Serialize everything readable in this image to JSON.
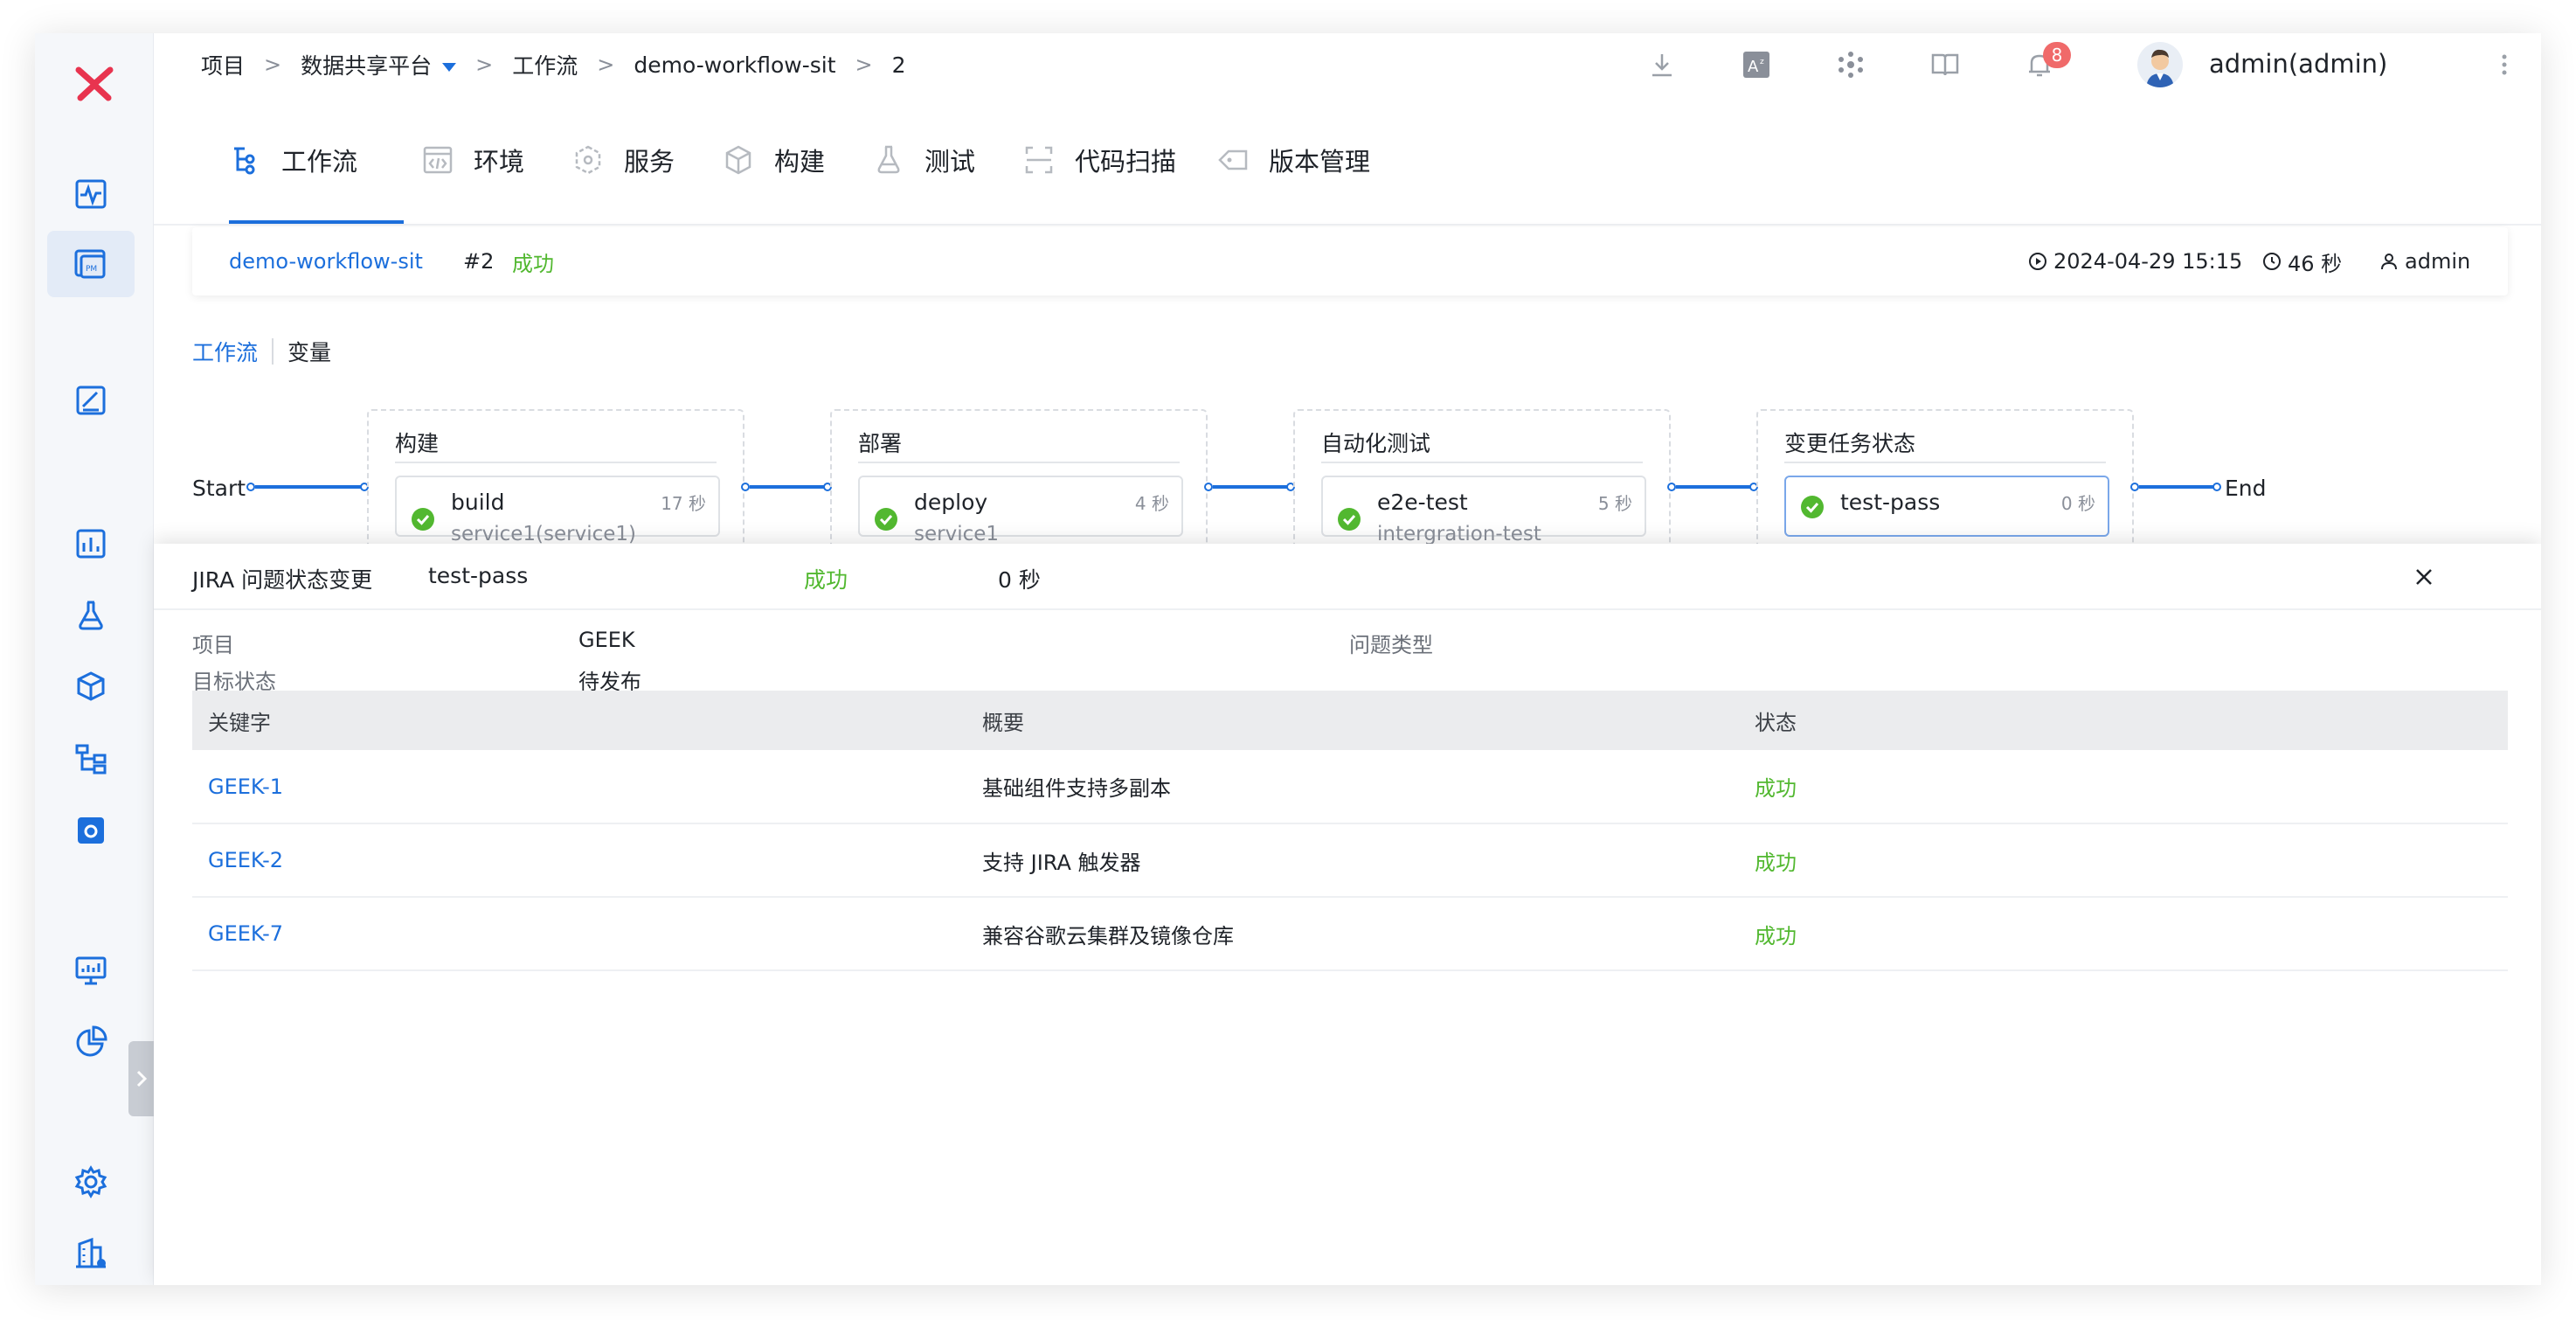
{
  "breadcrumb": {
    "items": [
      "项目",
      "数据共享平台",
      "工作流",
      "demo-workflow-sit",
      "2"
    ],
    "separator": ">"
  },
  "header": {
    "notification_count": "8",
    "username": "admin(admin)"
  },
  "tabs": [
    {
      "label": "工作流",
      "icon": "workflow-icon"
    },
    {
      "label": "环境",
      "icon": "code-icon"
    },
    {
      "label": "服务",
      "icon": "service-icon"
    },
    {
      "label": "构建",
      "icon": "cube-icon"
    },
    {
      "label": "测试",
      "icon": "flask-icon"
    },
    {
      "label": "代码扫描",
      "icon": "scan-icon"
    },
    {
      "label": "版本管理",
      "icon": "tag-icon"
    }
  ],
  "summary": {
    "workflow": "demo-workflow-sit",
    "run": "#2",
    "status": "成功",
    "started_at": "2024-04-29 15:15",
    "duration": "46 秒",
    "creator": "admin"
  },
  "subtabs": [
    "工作流",
    "变量"
  ],
  "pipeline": {
    "start_label": "Start",
    "end_label": "End",
    "stages": [
      {
        "title": "构建",
        "job": {
          "name": "build",
          "sub": "service1(service1)",
          "time": "17 秒"
        }
      },
      {
        "title": "部署",
        "job": {
          "name": "deploy",
          "sub": "service1",
          "time": "4 秒"
        }
      },
      {
        "title": "自动化测试",
        "job": {
          "name": "e2e-test",
          "sub": "intergration-test",
          "time": "5 秒"
        }
      },
      {
        "title": "变更任务状态",
        "job": {
          "name": "test-pass",
          "sub": "",
          "time": "0 秒"
        }
      }
    ]
  },
  "drawer": {
    "title": "JIRA 问题状态变更",
    "job": "test-pass",
    "status": "成功",
    "duration": "0 秒",
    "meta": {
      "project_label": "项目",
      "project_value": "GEEK",
      "issue_type_label": "问题类型",
      "target_status_label": "目标状态",
      "target_status_value": "待发布"
    },
    "table": {
      "headers": [
        "关键字",
        "概要",
        "状态"
      ],
      "rows": [
        {
          "key": "GEEK-1",
          "summary": "基础组件支持多副本",
          "status": "成功"
        },
        {
          "key": "GEEK-2",
          "summary": "支持 JIRA 触发器",
          "status": "成功"
        },
        {
          "key": "GEEK-7",
          "summary": "兼容谷歌云集群及镜像仓库",
          "status": "成功"
        }
      ]
    }
  },
  "colors": {
    "accent": "#1c6fdc",
    "success": "#52b830",
    "logo": "#e8344f",
    "badge": "#f06a6a"
  }
}
